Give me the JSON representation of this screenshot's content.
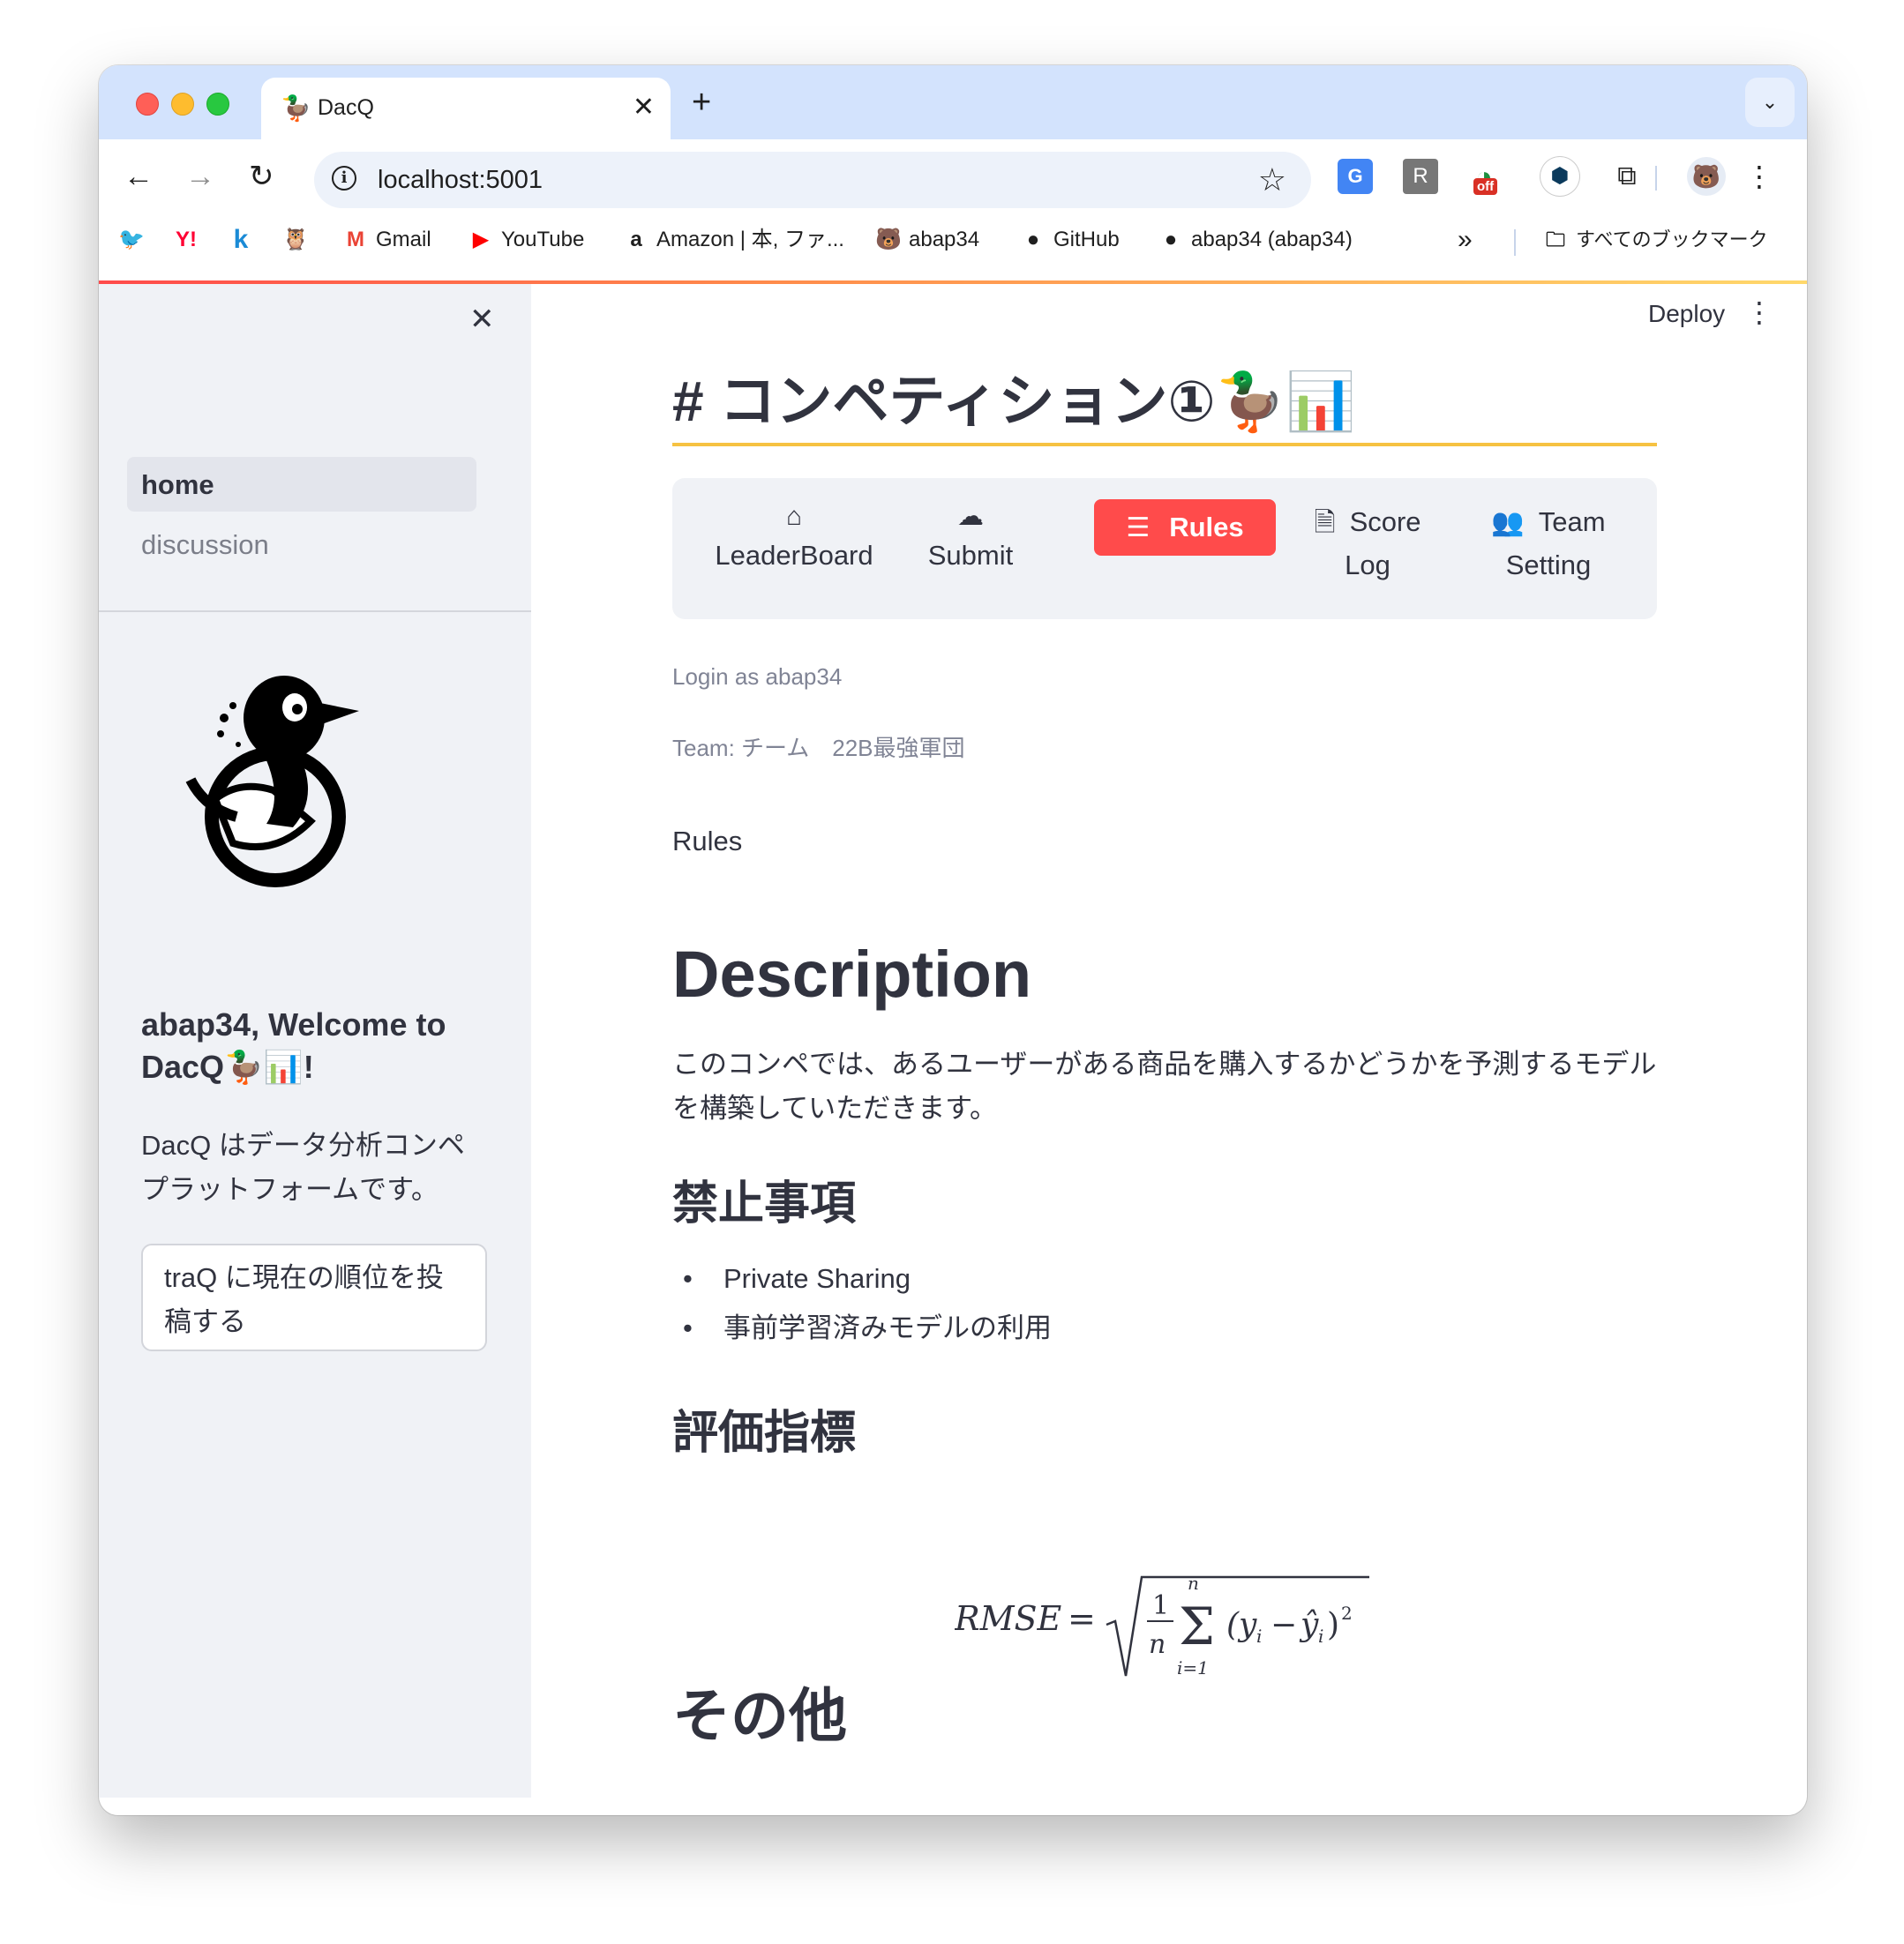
{
  "browser": {
    "tab_title": "DacQ",
    "tab_favicon": "🦆",
    "tab_close": "✕",
    "new_tab": "+",
    "tab_list_icon": "chevron-down-icon",
    "url": "localhost:5001",
    "bookmarks": [
      {
        "icon": "twitter-icon",
        "glyph": "🐦",
        "label": ""
      },
      {
        "icon": "yahoo-icon",
        "glyph": "Y!",
        "label": ""
      },
      {
        "icon": "k-icon",
        "glyph": "k",
        "label": ""
      },
      {
        "icon": "owl-icon",
        "glyph": "🦉",
        "label": ""
      },
      {
        "icon": "gmail-icon",
        "glyph": "M",
        "label": "Gmail"
      },
      {
        "icon": "youtube-icon",
        "glyph": "▶",
        "label": "YouTube"
      },
      {
        "icon": "amazon-icon",
        "glyph": "a",
        "label": "Amazon | 本, ファ..."
      },
      {
        "icon": "bear-icon",
        "glyph": "🐻",
        "label": "abap34"
      },
      {
        "icon": "github-icon",
        "glyph": "●",
        "label": "GitHub"
      },
      {
        "icon": "github-icon",
        "glyph": "●",
        "label": "abap34 (abap34)"
      }
    ],
    "bookmarks_overflow": "»",
    "all_bookmarks": "すべてのブックマーク"
  },
  "sidebar": {
    "nav": [
      {
        "label": "home",
        "active": true
      },
      {
        "label": "discussion",
        "active": false
      }
    ],
    "welcome": "abap34, Welcome to DacQ🦆📊!",
    "description": "DacQ はデータ分析コンペプラットフォームです。",
    "post_button": "traQ に現在の順位を投稿する"
  },
  "header": {
    "deploy": "Deploy"
  },
  "page": {
    "title": "# コンペティション①🦆📊",
    "menu": {
      "leaderboard": {
        "label": "LeaderBoard",
        "icon": "home-icon"
      },
      "submit": {
        "label": "Submit",
        "icon": "cloud-upload-icon"
      },
      "rules": {
        "label": "Rules",
        "icon": "list-icon",
        "selected": true
      },
      "score_log": {
        "label": "Score Log",
        "icon": "document-icon"
      },
      "team_setting": {
        "label": "Team Setting",
        "icon": "people-icon"
      }
    },
    "login_caption": "Login as abap34",
    "team_caption": "Team: チーム　22B最強軍団",
    "section_label": "Rules",
    "description_heading": "Description",
    "description_text": "このコンペでは、あるユーザーがある商品を購入するかどうかを予測するモデルを構築していただきます。",
    "prohibited_heading": "禁止事項",
    "prohibited_items": [
      "Private Sharing",
      "事前学習済みモデルの利用"
    ],
    "metric_heading": "評価指標",
    "metric_formula": "RMSE = √( (1/n) Σ_{i=1}^{n} (y_i − ŷ_i)² )",
    "other_heading": "その他"
  },
  "colors": {
    "accent": "#ff4b4b",
    "title_rule": "#f6c242",
    "sidebar_bg": "#f0f2f6",
    "tabstrip_bg": "#d3e3fd"
  }
}
